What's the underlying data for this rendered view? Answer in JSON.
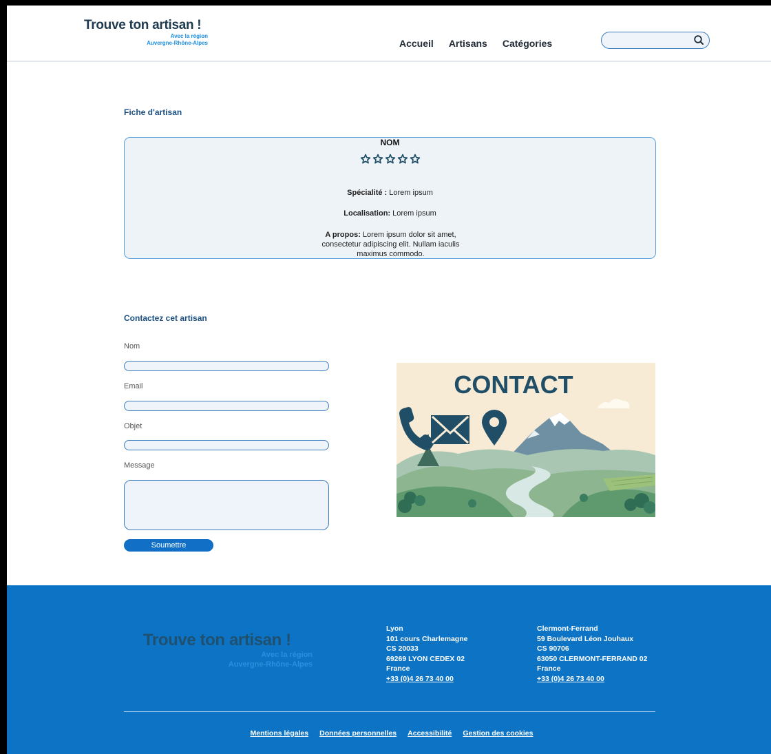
{
  "header": {
    "logo_title": "Trouve ton artisan !",
    "logo_sub1": "Avec la région",
    "logo_sub2": "Auvergne-Rhône-Alpes",
    "nav": [
      "Accueil",
      "Artisans",
      "Catégories"
    ],
    "search_value": ""
  },
  "fiche": {
    "title": "Fiche d'artisan",
    "name": "NOM",
    "rating": 0,
    "rating_max": 5,
    "specialite_label": "Spécialité :",
    "specialite_value": " Lorem ipsum",
    "localisation_label": "Localisation:",
    "localisation_value": " Lorem ipsum",
    "apropos_label": "A propos:",
    "apropos_value": " Lorem ipsum dolor sit amet, consectetur adipiscing elit. Nullam iaculis maximus commodo."
  },
  "contact": {
    "title": "Contactez cet artisan",
    "label_nom": "Nom",
    "label_email": "Email",
    "label_objet": "Objet",
    "label_message": "Message",
    "submit": "Soumettre",
    "image_text": "CONTACT"
  },
  "footer": {
    "logo_title": "Trouve ton artisan !",
    "logo_sub1": "Avec la région",
    "logo_sub2": "Auvergne-Rhône-Alpes",
    "lyon": {
      "city": "Lyon",
      "street": "101 cours Charlemagne",
      "cs": "CS 20033",
      "postal": "69269 LYON CEDEX 02",
      "country": "France",
      "phone": "+33 (0)4 26 73 40 00"
    },
    "clermont": {
      "city": "Clermont-Ferrand",
      "street": "59 Boulevard Léon Jouhaux",
      "cs": "CS 90706",
      "postal": "63050 CLERMONT-FERRAND 02",
      "country": "France",
      "phone": "+33 (0)4 26 73 40 00"
    },
    "links": [
      "Mentions légales",
      "Données personnelles",
      "Accessibilité",
      "Gestion des cookies"
    ]
  },
  "colors": {
    "primary_blue": "#0d74c5",
    "dark_navy": "#1f3a4f",
    "accent_blue": "#1d8ee0",
    "card_bg": "#eef3f8"
  }
}
